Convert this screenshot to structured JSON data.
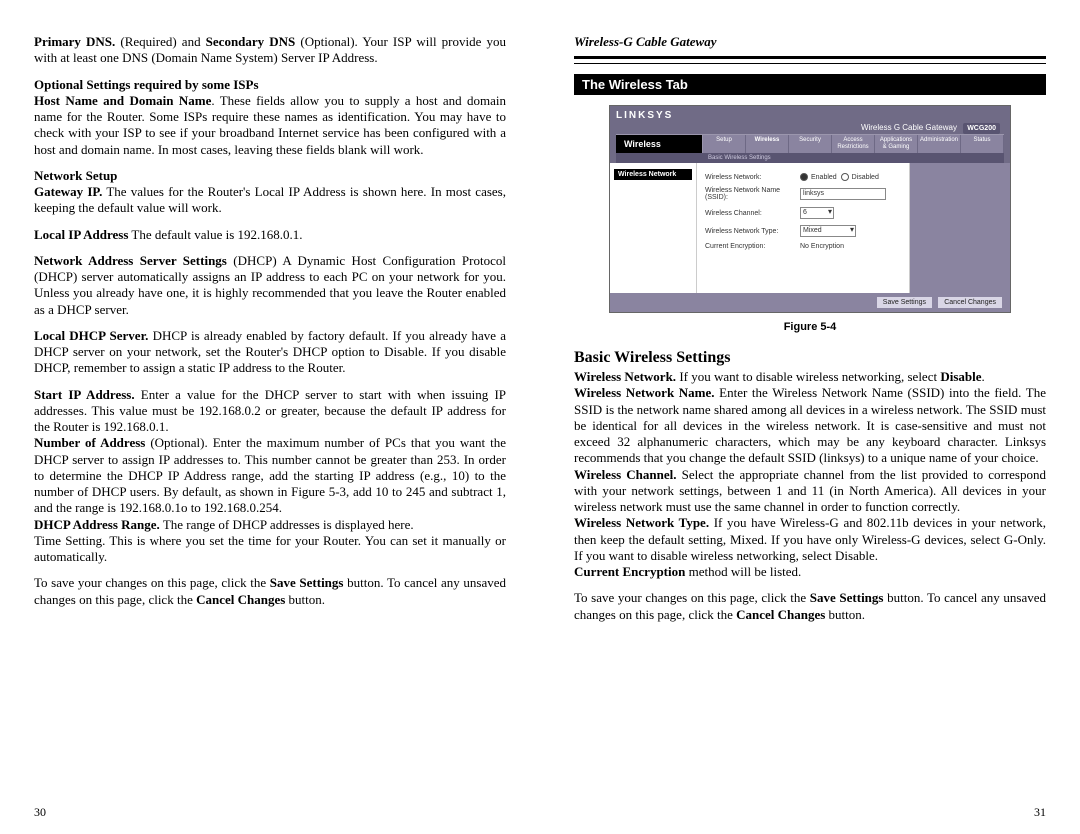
{
  "left": {
    "p1": {
      "b1": "Primary DNS.",
      "t1": " (Required) and ",
      "b2": "Secondary DNS",
      "t2": " (Optional). Your ISP will provide you with at least one DNS (Domain Name System) Server IP Address."
    },
    "opt_heading": "Optional Settings required by some ISPs",
    "p2": {
      "b1": "Host Name and Domain Name",
      "t1": ". These fields allow you to supply a host and domain name for the Router. Some ISPs require these names as identification. You may have to check with your ISP to see if your broadband Internet service has been configured with a host and domain name. In most cases, leaving these fields blank will work."
    },
    "net_heading": "Network Setup",
    "p3": {
      "b1": "Gateway IP.",
      "t1": " The values for the Router's Local IP Address is shown here. In most cases, keeping the default value will work."
    },
    "p4": {
      "b1": "Local IP Address",
      "t1": "  The default value is 192.168.0.1."
    },
    "p5": {
      "b1": "Network Address Server Settings",
      "t1": " (DHCP)  A Dynamic Host Configuration Protocol (DHCP) server automatically assigns an IP address to each PC on your network for you. Unless you already have one, it is highly recommended that you leave the Router enabled as a DHCP server."
    },
    "p6": {
      "b1": "Local DHCP Server.",
      "t1": " DHCP is already enabled by factory default. If you already have a DHCP server on your network, set the Router's DHCP option to Disable. If you disable DHCP, remember to assign a static IP address to the Router."
    },
    "p7": {
      "b1": "Start IP Address.",
      "t1": " Enter a value for the DHCP server to start with when issuing IP addresses. This value must be 192.168.0.2 or greater, because the default IP address for the Router is 192.168.0.1."
    },
    "p8": {
      "b1": "Number of Address",
      "t1": " (Optional). Enter the maximum number of PCs that you want the DHCP server to assign IP addresses to. This number cannot be greater than 253.  In order to determine the DHCP IP Address range, add the starting IP address (e.g., 10) to the number of DHCP users.  By default, as shown in Figure 5-3, add 10 to 245 and subtract 1, and the range is 192.168.0.1o to 192.168.0.254."
    },
    "p9": {
      "b1": "DHCP Address Range.",
      "t1": " The range of DHCP addresses is displayed here."
    },
    "p10": "Time Setting. This is where you set the time for your Router. You can set it manually or automatically.",
    "p11": {
      "t1": "To save your changes on this page, click the ",
      "b1": "Save Settings",
      "t2": " button. To cancel any unsaved changes on this page, click the ",
      "b2": "Cancel Changes",
      "t3": " button."
    },
    "page_num": "30"
  },
  "right": {
    "running_head": "Wireless-G Cable Gateway",
    "section_bar": "The Wireless Tab",
    "figure": {
      "brand": "LINKSYS",
      "product": "Wireless G Cable Gateway",
      "model": "WCG200",
      "nav_label": "Wireless",
      "tabs": [
        "Setup",
        "Wireless",
        "Security",
        "Access Restrictions",
        "Applications & Gaming",
        "Administration",
        "Status"
      ],
      "sub": "Basic Wireless Settings",
      "side_label": "Wireless Network",
      "fields": {
        "net_label": "Wireless Network:",
        "net_enabled": "Enabled",
        "net_disabled": "Disabled",
        "name_label": "Wireless Network Name (SSID):",
        "name_value": "linksys",
        "channel_label": "Wireless Channel:",
        "channel_value": "6",
        "type_label": "Wireless Network Type:",
        "type_value": "Mixed",
        "enc_label": "Current Encryption:",
        "enc_value": "No Encryption"
      },
      "btn_save": "Save Settings",
      "btn_cancel": "Cancel Changes",
      "caption": "Figure 5-4"
    },
    "heading": "Basic Wireless Settings",
    "p1": {
      "b1": "Wireless Network.",
      "t1": " If you want to disable wireless networking, select ",
      "b2": "Disable",
      "t2": "."
    },
    "p2": {
      "b1": "Wireless Network Name.",
      "t1": " Enter the Wireless Network Name (SSID) into the field. The SSID is the network name shared among all devices in a wireless network. The SSID must be identical for all devices in the wireless network. It is case-sensitive and must not exceed 32 alphanumeric characters, which may be any keyboard character. Linksys recommends that you change the default SSID (linksys) to a unique name of your choice."
    },
    "p3": {
      "b1": "Wireless Channel.",
      "t1": " Select the appropriate channel from the list provided to correspond with your network settings, between 1 and 11 (in North America). All devices in your wireless network must use the same channel in order to function correctly."
    },
    "p4": {
      "b1": "Wireless Network Type.",
      "t1": " If you have Wireless-G and 802.11b devices in your network, then keep the default setting, Mixed. If you have only Wireless-G devices, select G-Only. If you want to disable wireless networking, select Disable."
    },
    "p5": {
      "b1": "Current Encryption",
      "t1": " method will be listed."
    },
    "p6": {
      "t1": "To save your changes on this page, click the ",
      "b1": "Save Settings",
      "t2": " button. To cancel any unsaved changes on this page, click the ",
      "b2": "Cancel Changes",
      "t3": " button."
    },
    "page_num": "31"
  }
}
